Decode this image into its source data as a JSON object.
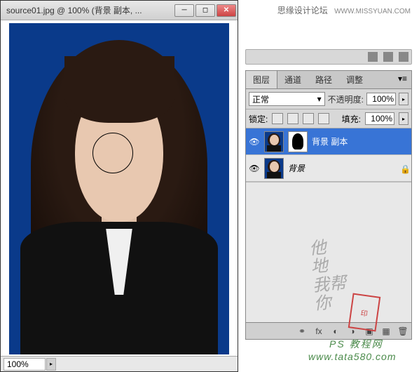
{
  "document": {
    "title": "source01.jpg @ 100% (背景 副本, ...",
    "zoom": "100%"
  },
  "watermark": {
    "top_text": "思缘设计论坛",
    "top_url": "WWW.MISSYUAN.COM",
    "bottom1": "PS 教程网",
    "bottom2": "www.tata580.com"
  },
  "panel": {
    "tabs": [
      "图层",
      "通道",
      "路径",
      "调整"
    ],
    "active_tab_index": 0,
    "blend_mode": "正常",
    "opacity_label": "不透明度:",
    "opacity_value": "100%",
    "lock_label": "锁定:",
    "fill_label": "填充:",
    "fill_value": "100%",
    "layers": [
      {
        "name": "背景 副本",
        "visible": true,
        "has_mask": true,
        "selected": true,
        "locked": false
      },
      {
        "name": "背景",
        "visible": true,
        "has_mask": false,
        "selected": false,
        "locked": true
      }
    ]
  }
}
